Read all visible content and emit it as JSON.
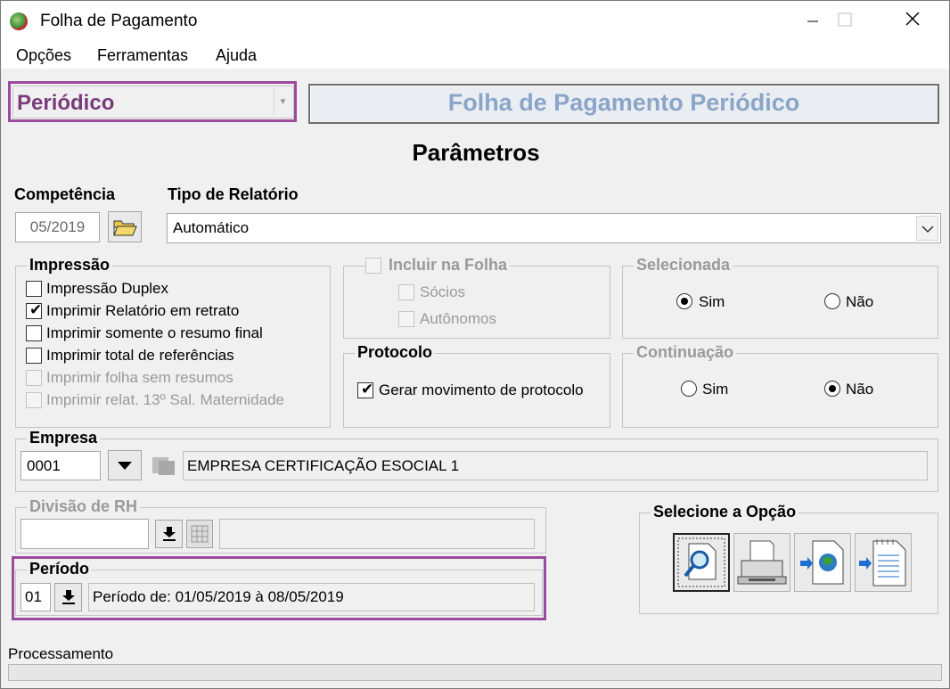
{
  "window": {
    "title": "Folha de Pagamento"
  },
  "menu": [
    "Opções",
    "Ferramentas",
    "Ajuda"
  ],
  "mode_combo": {
    "value": "Periódico"
  },
  "header": "Folha de Pagamento Periódico",
  "section_title": "Parâmetros",
  "competencia": {
    "label": "Competência",
    "value": "05/2019"
  },
  "tipo_relatorio": {
    "label": "Tipo de Relatório",
    "value": "Automático"
  },
  "impressao": {
    "legend": "Impressão",
    "options": [
      {
        "label": "Impressão Duplex",
        "checked": false,
        "enabled": true
      },
      {
        "label": "Imprimir Relatório em retrato",
        "checked": true,
        "enabled": true
      },
      {
        "label": "Imprimir somente o resumo final",
        "checked": false,
        "enabled": true
      },
      {
        "label": "Imprimir total de referências",
        "checked": false,
        "enabled": true
      },
      {
        "label": "Imprimir folha sem resumos",
        "checked": false,
        "enabled": false
      },
      {
        "label": "Imprimir relat. 13º Sal. Maternidade",
        "checked": false,
        "enabled": false
      }
    ]
  },
  "incluir_folha": {
    "legend": "Incluir na Folha",
    "options": [
      "Sócios",
      "Autônomos"
    ]
  },
  "selecionada": {
    "legend": "Selecionada",
    "sim": "Sim",
    "nao": "Não",
    "selected": "Sim"
  },
  "protocolo": {
    "legend": "Protocolo",
    "option": "Gerar movimento de protocolo",
    "checked": true
  },
  "continuacao": {
    "legend": "Continuação",
    "sim": "Sim",
    "nao": "Não",
    "selected": "Não"
  },
  "empresa": {
    "legend": "Empresa",
    "code": "0001",
    "name": "EMPRESA CERTIFICAÇÃO ESOCIAL 1"
  },
  "divisao_rh": {
    "legend": "Divisão de RH",
    "code": "",
    "name": ""
  },
  "periodo": {
    "legend": "Período",
    "code": "01",
    "text": "Período de: 01/05/2019 à 08/05/2019"
  },
  "selecione_opcao": {
    "legend": "Selecione a Opção",
    "buttons": [
      "preview-icon",
      "printer-icon",
      "export-web-icon",
      "export-file-icon"
    ]
  },
  "status": {
    "label": "Processamento"
  },
  "colors": {
    "highlight": "#9b4a9e",
    "header_text": "#8aa5c8"
  }
}
